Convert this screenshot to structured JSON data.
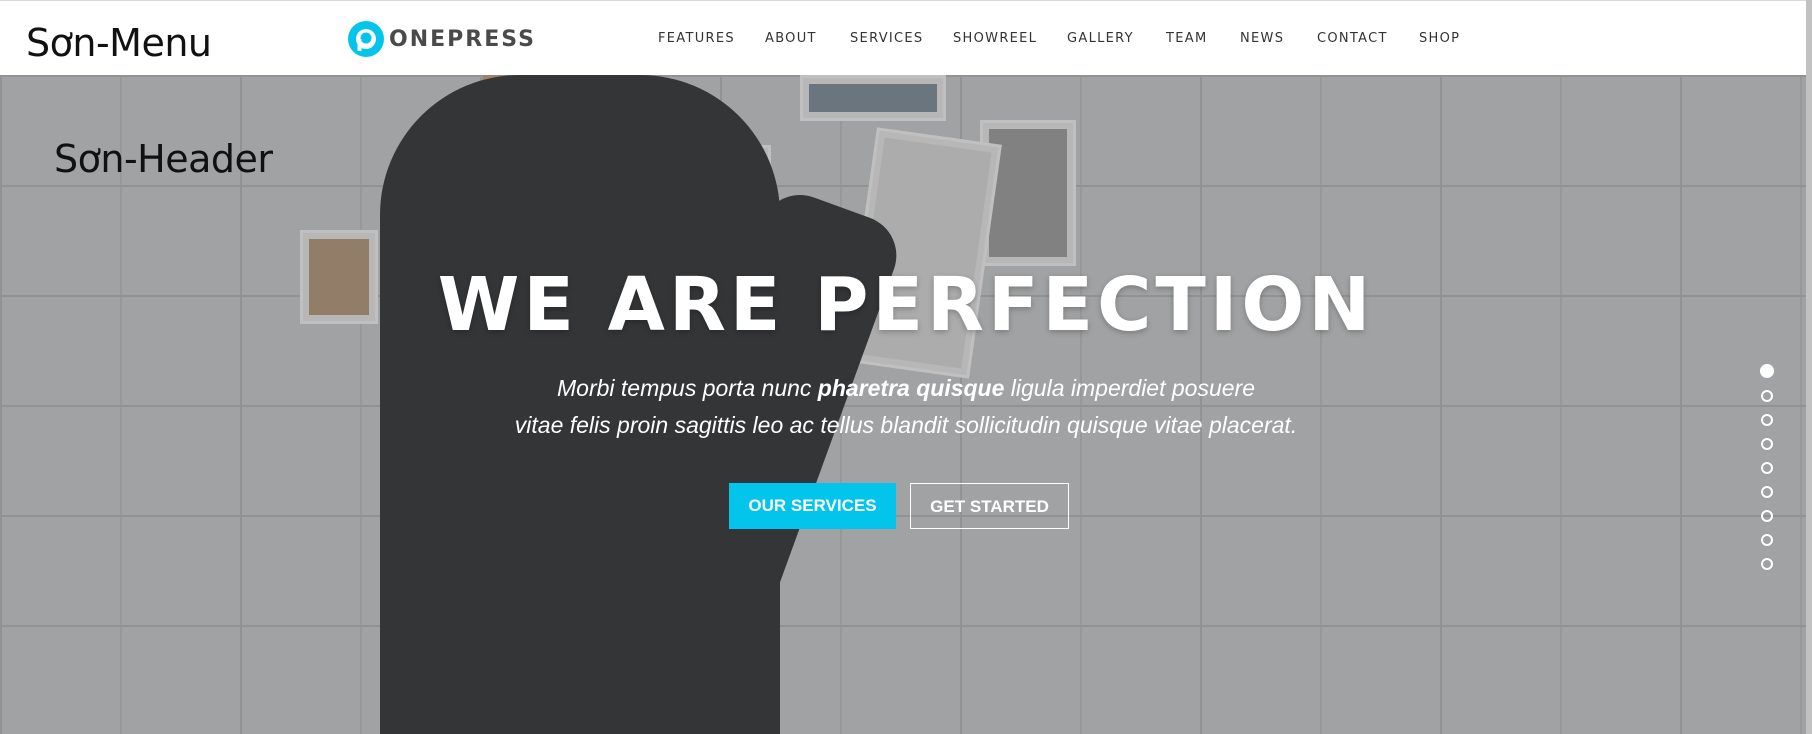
{
  "annotations": {
    "menu_label": "Sơn-Menu",
    "header_label": "Sơn-Header"
  },
  "brand": {
    "logo_text": "ONEPRESS",
    "accent_color": "#03c4eb",
    "logo_icon": "p-logo-icon"
  },
  "nav": {
    "items": [
      {
        "label": "FEATURES"
      },
      {
        "label": "ABOUT"
      },
      {
        "label": "SERVICES"
      },
      {
        "label": "SHOWREEL"
      },
      {
        "label": "GALLERY"
      },
      {
        "label": "TEAM"
      },
      {
        "label": "NEWS"
      },
      {
        "label": "CONTACT"
      },
      {
        "label": "SHOP"
      }
    ]
  },
  "hero": {
    "title": "WE ARE PERFECTION",
    "desc_line1_a": "Morbi tempus porta nunc ",
    "desc_line1_bold": "pharetra quisque",
    "desc_line1_b": " ligula imperdiet posuere",
    "desc_line2": "vitae felis proin sagittis leo ac tellus blandit sollicitudin quisque vitae placerat.",
    "primary_button": "OUR SERVICES",
    "secondary_button": "GET STARTED"
  },
  "section_dots": {
    "count": 9,
    "active_index": 0
  }
}
